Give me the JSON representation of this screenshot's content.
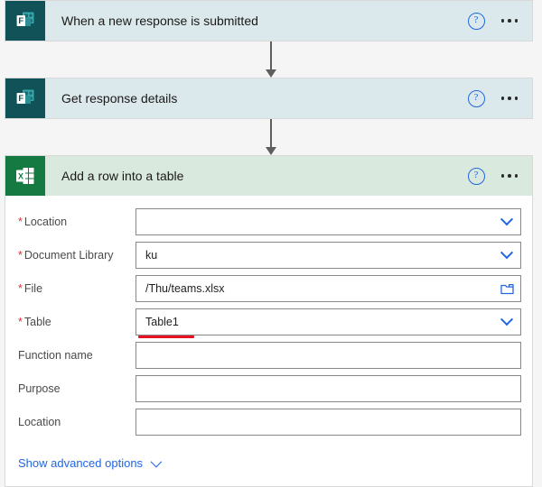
{
  "flow": {
    "steps": [
      {
        "id": "trigger",
        "title": "When a new response is submitted",
        "app": "microsoft-forms",
        "help_icon": "help-circle-icon",
        "menu_icon": "ellipsis-icon"
      },
      {
        "id": "get-response",
        "title": "Get response details",
        "app": "microsoft-forms",
        "help_icon": "help-circle-icon",
        "menu_icon": "ellipsis-icon"
      },
      {
        "id": "add-row",
        "title": "Add a row into a table",
        "app": "excel",
        "help_icon": "help-circle-icon",
        "menu_icon": "ellipsis-icon"
      }
    ],
    "connector_icon": "arrow-down-icon"
  },
  "form": {
    "fields": [
      {
        "label": "Location",
        "required": true,
        "value": "",
        "control": "dropdown",
        "icon": "chevron-down-icon"
      },
      {
        "label": "Document Library",
        "required": true,
        "value": "ku",
        "control": "dropdown",
        "icon": "chevron-down-icon"
      },
      {
        "label": "File",
        "required": true,
        "value": "/Thu/teams.xlsx",
        "control": "file-picker",
        "icon": "folder-icon"
      },
      {
        "label": "Table",
        "required": true,
        "value": "Table1",
        "control": "dropdown",
        "icon": "chevron-down-icon",
        "annotated": true
      },
      {
        "label": "Function name",
        "required": false,
        "value": "",
        "control": "text"
      },
      {
        "label": "Purpose",
        "required": false,
        "value": "",
        "control": "text"
      },
      {
        "label": "Location",
        "required": false,
        "value": "",
        "control": "text"
      }
    ],
    "advanced": {
      "label": "Show advanced options",
      "icon": "chevron-down-icon"
    }
  },
  "colors": {
    "forms_header": "#dbe9ec",
    "forms_icon": "#105257",
    "excel_header": "#d9e9dd",
    "excel_icon": "#157a42",
    "link_blue": "#2266e3",
    "required_red": "#d13438",
    "annotation_red": "#e81123",
    "page_background": "#f5f5f5"
  }
}
